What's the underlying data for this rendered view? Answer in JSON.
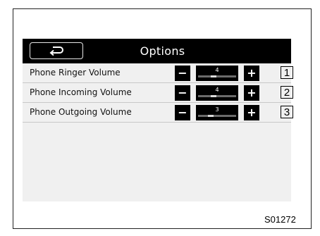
{
  "header": {
    "title": "Options",
    "back_icon": "back-arrow-icon"
  },
  "rows": [
    {
      "label": "Phone Ringer Volume",
      "value": "4",
      "level": 4,
      "minus": "−",
      "plus": "+",
      "callout": "1"
    },
    {
      "label": "Phone Incoming Volume",
      "value": "4",
      "level": 4,
      "minus": "−",
      "plus": "+",
      "callout": "2"
    },
    {
      "label": "Phone Outgoing Volume",
      "value": "3",
      "level": 3,
      "minus": "−",
      "plus": "+",
      "callout": "3"
    }
  ],
  "figure_code": "S01272",
  "colors": {
    "titlebar": "#000000",
    "screen_bg": "#f0f0f0",
    "button": "#000000",
    "button_text": "#ffffff"
  }
}
